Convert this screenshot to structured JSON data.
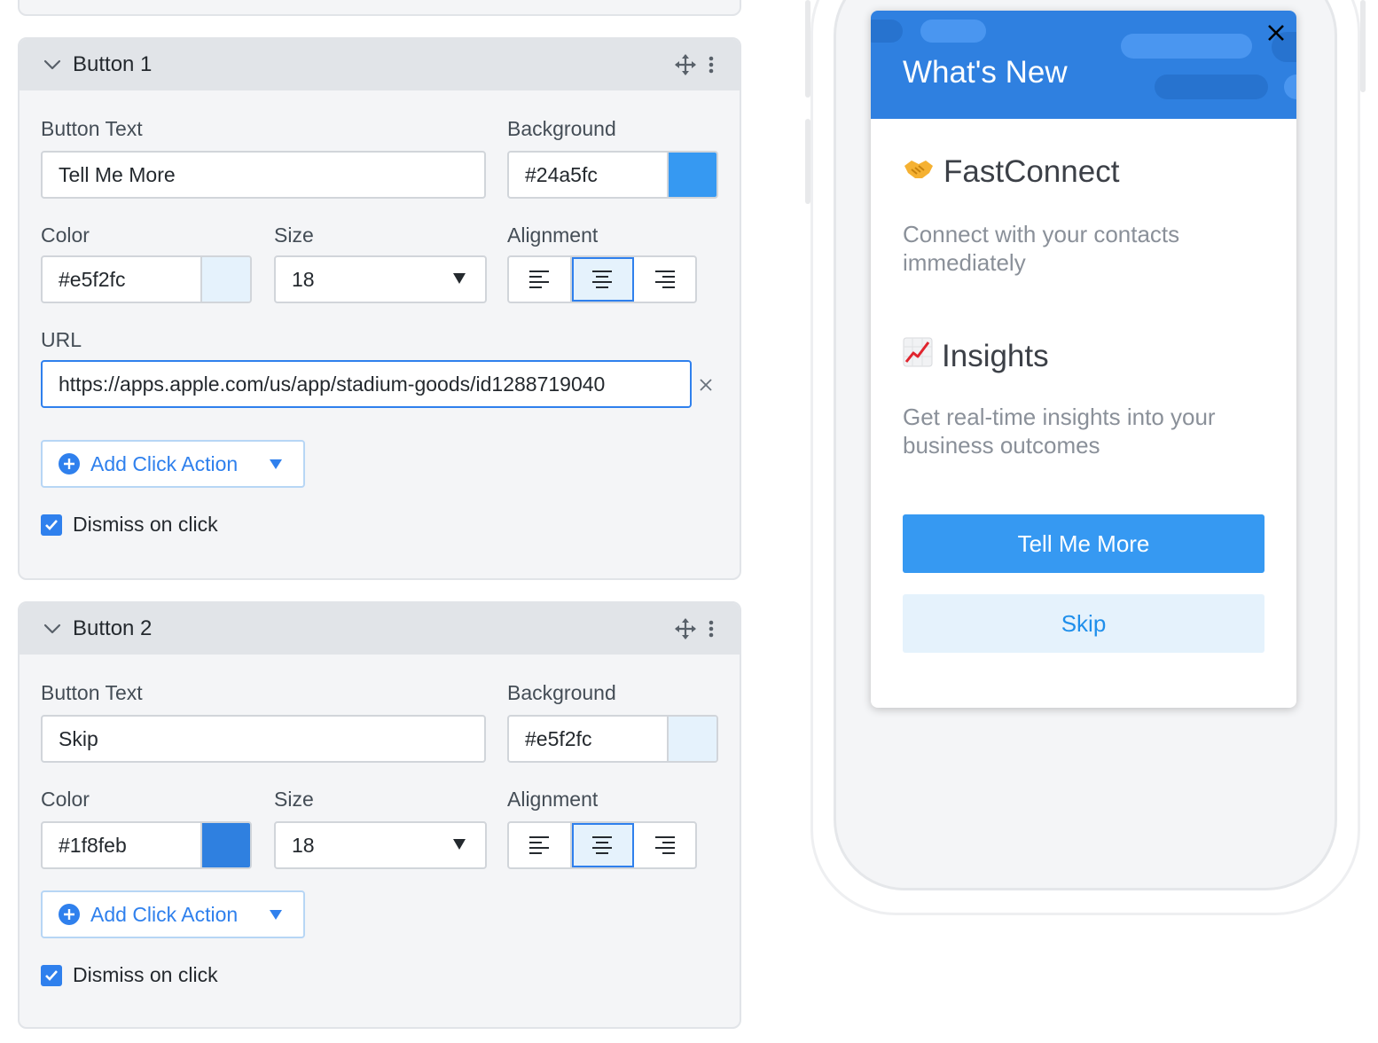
{
  "buttons": [
    {
      "title": "Button 1",
      "button_text_label": "Button Text",
      "button_text_value": "Tell Me More",
      "background_label": "Background",
      "background_value": "#24a5fc",
      "background_swatch": "#3699f2",
      "color_label": "Color",
      "color_value": "#e5f2fc",
      "color_swatch": "#e5f2fc",
      "size_label": "Size",
      "size_value": "18",
      "alignment_label": "Alignment",
      "alignment_selected": "center",
      "url_label": "URL",
      "url_value": "https://apps.apple.com/us/app/stadium-goods/id1288719040",
      "add_click_action_label": "Add Click Action",
      "dismiss_on_click_label": "Dismiss on click",
      "dismiss_on_click_checked": true
    },
    {
      "title": "Button 2",
      "button_text_label": "Button Text",
      "button_text_value": "Skip",
      "background_label": "Background",
      "background_value": "#e5f2fc",
      "background_swatch": "#e5f2fc",
      "color_label": "Color",
      "color_value": "#1f8feb",
      "color_swatch": "#2f80e0",
      "size_label": "Size",
      "size_value": "18",
      "alignment_label": "Alignment",
      "alignment_selected": "center",
      "add_click_action_label": "Add Click Action",
      "dismiss_on_click_label": "Dismiss on click",
      "dismiss_on_click_checked": true
    }
  ],
  "preview": {
    "title": "What's New",
    "features": [
      {
        "emoji": "🤝",
        "title": "FastConnect",
        "description": "Connect with your contacts immediately"
      },
      {
        "emoji": "📈",
        "title": "Insights",
        "description": "Get real-time insights into your business outcomes"
      }
    ],
    "primary_button": "Tell Me More",
    "secondary_button": "Skip",
    "header_color": "#2f80e0",
    "primary_color": "#3699f2",
    "secondary_color": "#e5f2fc"
  },
  "icons": {
    "collapse": "chevron-down-icon",
    "move": "move-icon",
    "menu": "kebab-menu-icon",
    "align_left": "align-left-icon",
    "align_center": "align-center-icon",
    "align_right": "align-right-icon",
    "clear": "close-icon",
    "add": "plus-circle-icon",
    "check": "checkmark-icon",
    "modal_close": "close-icon"
  }
}
